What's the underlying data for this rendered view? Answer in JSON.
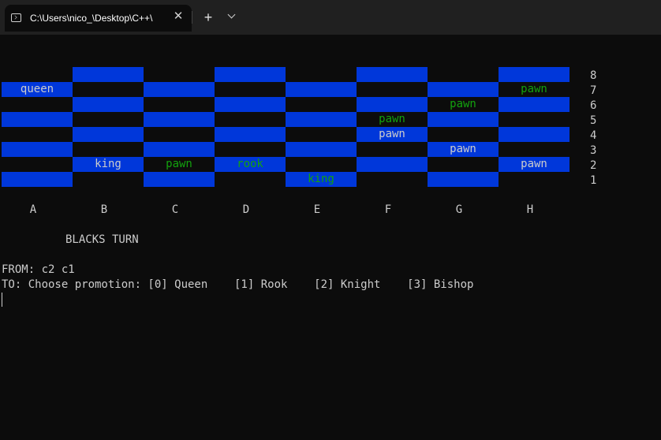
{
  "window": {
    "tab_title": "C:\\Users\\nico_\\Desktop\\C++\\",
    "new_tab_label": "+",
    "close_label": "✕"
  },
  "board": {
    "ranks": [
      "8",
      "7",
      "6",
      "5",
      "4",
      "3",
      "2",
      "1"
    ],
    "files": [
      "A",
      "B",
      "C",
      "D",
      "E",
      "F",
      "G",
      "H"
    ],
    "rows": [
      [
        {
          "t": "",
          "c": "w"
        },
        {
          "t": "",
          "c": "w"
        },
        {
          "t": "",
          "c": "w"
        },
        {
          "t": "",
          "c": "w"
        },
        {
          "t": "",
          "c": "w"
        },
        {
          "t": "",
          "c": "w"
        },
        {
          "t": "",
          "c": "w"
        },
        {
          "t": "",
          "c": "w"
        }
      ],
      [
        {
          "t": "queen",
          "c": "w"
        },
        {
          "t": "",
          "c": "w"
        },
        {
          "t": "",
          "c": "w"
        },
        {
          "t": "",
          "c": "w"
        },
        {
          "t": "",
          "c": "w"
        },
        {
          "t": "",
          "c": "w"
        },
        {
          "t": "",
          "c": "w"
        },
        {
          "t": "pawn",
          "c": "g"
        }
      ],
      [
        {
          "t": "",
          "c": "w"
        },
        {
          "t": "",
          "c": "w"
        },
        {
          "t": "",
          "c": "w"
        },
        {
          "t": "",
          "c": "w"
        },
        {
          "t": "",
          "c": "w"
        },
        {
          "t": "",
          "c": "w"
        },
        {
          "t": "pawn",
          "c": "g"
        },
        {
          "t": "",
          "c": "w"
        }
      ],
      [
        {
          "t": "",
          "c": "w"
        },
        {
          "t": "",
          "c": "w"
        },
        {
          "t": "",
          "c": "w"
        },
        {
          "t": "",
          "c": "w"
        },
        {
          "t": "",
          "c": "w"
        },
        {
          "t": "pawn",
          "c": "g"
        },
        {
          "t": "",
          "c": "w"
        },
        {
          "t": "",
          "c": "w"
        }
      ],
      [
        {
          "t": "",
          "c": "w"
        },
        {
          "t": "",
          "c": "w"
        },
        {
          "t": "",
          "c": "w"
        },
        {
          "t": "",
          "c": "w"
        },
        {
          "t": "",
          "c": "w"
        },
        {
          "t": "pawn",
          "c": "w"
        },
        {
          "t": "",
          "c": "w"
        },
        {
          "t": "",
          "c": "w"
        }
      ],
      [
        {
          "t": "",
          "c": "w"
        },
        {
          "t": "",
          "c": "w"
        },
        {
          "t": "",
          "c": "w"
        },
        {
          "t": "",
          "c": "w"
        },
        {
          "t": "",
          "c": "w"
        },
        {
          "t": "",
          "c": "w"
        },
        {
          "t": "pawn",
          "c": "w"
        },
        {
          "t": "",
          "c": "w"
        }
      ],
      [
        {
          "t": "",
          "c": "w"
        },
        {
          "t": "king",
          "c": "w"
        },
        {
          "t": "pawn",
          "c": "g"
        },
        {
          "t": "rook",
          "c": "g"
        },
        {
          "t": "",
          "c": "w"
        },
        {
          "t": "",
          "c": "w"
        },
        {
          "t": "",
          "c": "w"
        },
        {
          "t": "pawn",
          "c": "w"
        }
      ],
      [
        {
          "t": "",
          "c": "w"
        },
        {
          "t": "",
          "c": "w"
        },
        {
          "t": "",
          "c": "w"
        },
        {
          "t": "",
          "c": "w"
        },
        {
          "t": "king",
          "c": "g"
        },
        {
          "t": "",
          "c": "w"
        },
        {
          "t": "",
          "c": "w"
        },
        {
          "t": "",
          "c": "w"
        }
      ]
    ],
    "colors": {
      "blue": "#0037da",
      "white_piece": "#cccccc",
      "green_piece": "#13a10e",
      "background": "#0c0c0c"
    }
  },
  "console": {
    "turn": "BLACKS TURN",
    "from_line": "FROM: c2 c1",
    "to_line": "TO: Choose promotion: [0] Queen    [1] Rook    [2] Knight    [3] Bishop"
  }
}
